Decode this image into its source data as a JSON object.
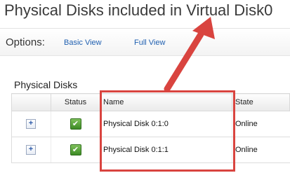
{
  "header": {
    "title": "Physical Disks included in Virtual Disk0"
  },
  "options": {
    "label": "Options:",
    "links": [
      "Basic View",
      "Full View"
    ]
  },
  "section": {
    "title": "Physical Disks"
  },
  "table": {
    "columns": [
      "",
      "Status",
      "Name",
      "State"
    ],
    "rows": [
      {
        "expand": "+",
        "status_icon": "check-ok-icon",
        "name": "Physical Disk 0:1:0",
        "state": "Online"
      },
      {
        "expand": "+",
        "status_icon": "check-ok-icon",
        "name": "Physical Disk 0:1:1",
        "state": "Online"
      }
    ]
  },
  "annotation": {
    "color": "#d9443f"
  }
}
